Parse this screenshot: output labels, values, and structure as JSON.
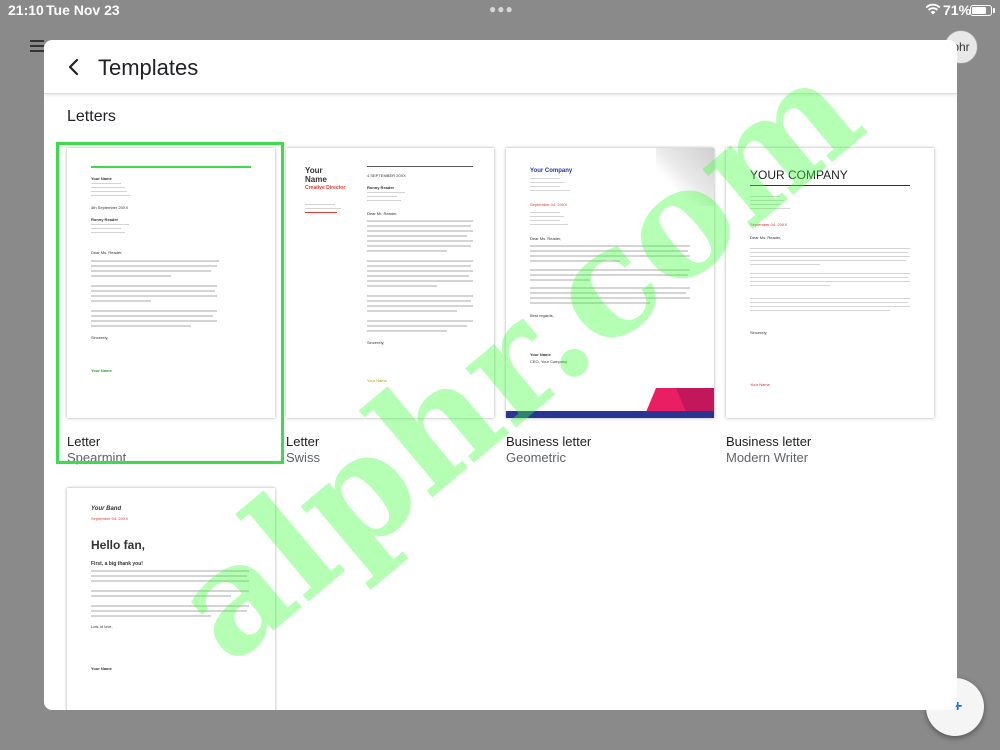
{
  "status_bar": {
    "time": "21:10",
    "date": "Tue Nov 23",
    "battery": "71%"
  },
  "background": {
    "avatar_text": "phr",
    "fab_text": "+"
  },
  "modal": {
    "title": "Templates"
  },
  "section": {
    "title": "Letters"
  },
  "templates": [
    {
      "name": "Letter",
      "variant": "Spearmint",
      "selected": true,
      "preview": {
        "your_name": "Your Name",
        "date": "4th September 20XX",
        "recipient": "Ronny Reader",
        "salutation": "Dear Ms. Reader,",
        "sincerely": "Sincerely,",
        "signature": "Your Name"
      }
    },
    {
      "name": "Letter",
      "variant": "Swiss",
      "preview": {
        "name_line1": "Your",
        "name_line2": "Name",
        "role": "Creative Director",
        "date": "4 SEPTEMBER 20XX",
        "recipient": "Ronny Reader",
        "salutation": "Dear Mr. Reader,",
        "closing": "Sincerely,",
        "signature": "Your Name"
      }
    },
    {
      "name": "Business letter",
      "variant": "Geometric",
      "preview": {
        "company": "Your Company",
        "date": "September 04, 20XX",
        "salutation": "Dear Ms. Reader,",
        "closing": "Best regards,",
        "signer": "Your Name",
        "signer_title": "CEO, Your Company"
      }
    },
    {
      "name": "Business letter",
      "variant": "Modern Writer",
      "preview": {
        "company": "YOUR COMPANY",
        "date": "September 04, 20XX",
        "salutation": "Dear Ms. Reader,",
        "closing": "Sincerely,",
        "signer": "Your Name"
      }
    },
    {
      "name": "",
      "variant": "",
      "preview": {
        "band": "Your Band",
        "date": "September 04, 20XX",
        "greeting": "Hello fan,",
        "intro": "First, a big thank you!",
        "closing": "Lots of love,",
        "signer": "Your Name"
      }
    }
  ],
  "watermark": "alphr.com",
  "colors": {
    "spearmint": "#3ddc4c",
    "swiss_red": "#e53935",
    "geometric_blue": "#283593",
    "geometric_pink": "#e91e63",
    "modern_red": "#d32f2f"
  },
  "icons": {
    "back": "chevron-left-icon",
    "wifi": "wifi-icon",
    "battery": "battery-icon"
  }
}
